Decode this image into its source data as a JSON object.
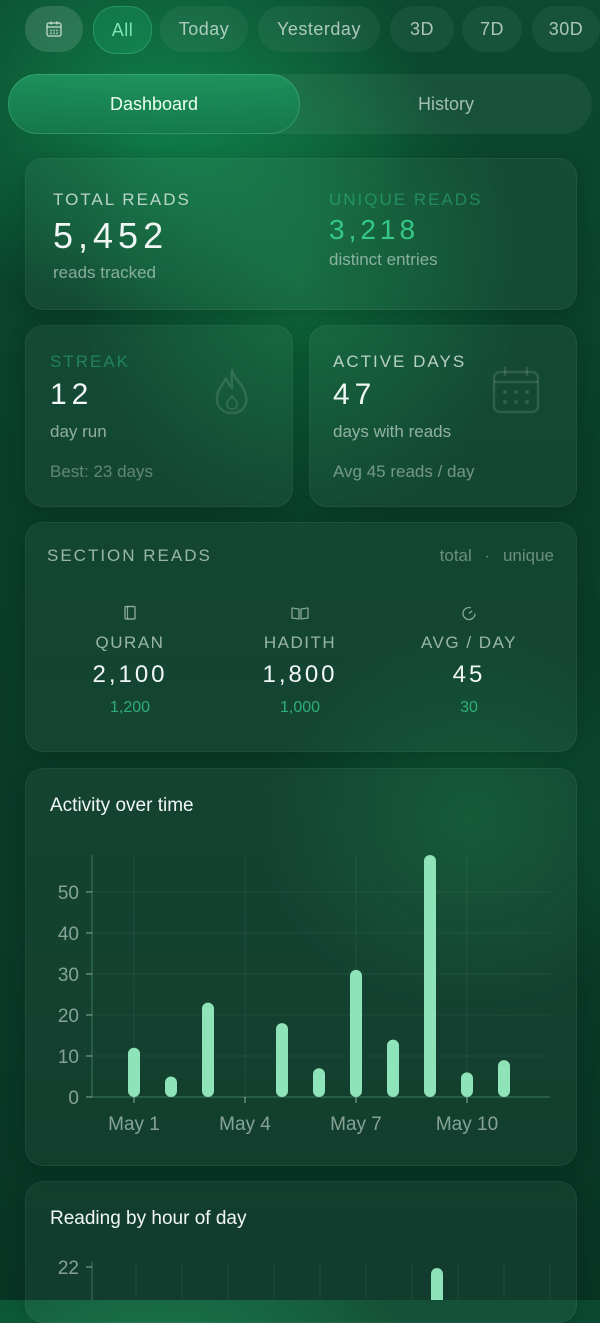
{
  "filters": {
    "calendar_icon": "calendar-icon",
    "chips": [
      {
        "label": "All",
        "active": true
      },
      {
        "label": "Today",
        "active": false
      },
      {
        "label": "Yesterday",
        "active": false
      },
      {
        "label": "3D",
        "active": false
      },
      {
        "label": "7D",
        "active": false
      },
      {
        "label": "30D",
        "active": false
      }
    ]
  },
  "tabs": [
    {
      "label": "Dashboard",
      "active": true
    },
    {
      "label": "History",
      "active": false
    }
  ],
  "summary": {
    "total": {
      "label": "TOTAL READS",
      "value": "5,452",
      "sub": "reads tracked"
    },
    "unique": {
      "label": "UNIQUE READS",
      "value": "3,218",
      "sub": "distinct entries"
    }
  },
  "streak": {
    "label": "STREAK",
    "value": "12",
    "sub": "day run",
    "best": "Best: 23 days",
    "icon": "flame-icon"
  },
  "active_days": {
    "label": "ACTIVE DAYS",
    "value": "47",
    "sub": "days with reads",
    "avg": "Avg 45 reads / day",
    "icon": "calendar-icon"
  },
  "section_reads": {
    "title": "SECTION READS",
    "legend_total": "total",
    "legend_sep": "·",
    "legend_unique": "unique",
    "columns": [
      {
        "name": "QURAN",
        "total": "2,100",
        "unique": "1,200",
        "icon": "book-icon"
      },
      {
        "name": "HADITH",
        "total": "1,800",
        "unique": "1,000",
        "icon": "open-book-icon"
      },
      {
        "name": "AVG / DAY",
        "total": "45",
        "unique": "30",
        "icon": "gauge-icon"
      }
    ]
  },
  "colors": {
    "accent": "#35c88a",
    "bar": "#8fe3b8",
    "background": "#0a3d2a"
  },
  "chart_data": [
    {
      "type": "bar",
      "title": "Activity over time",
      "x": [
        "May 1",
        "May 2",
        "May 3",
        "May 4",
        "May 5",
        "May 6",
        "May 7",
        "May 8",
        "May 9",
        "May 10",
        "May 11"
      ],
      "x_tick_labels": [
        "May 1",
        "May 4",
        "May 7",
        "May 10"
      ],
      "values": [
        12,
        5,
        23,
        0,
        18,
        7,
        31,
        14,
        59,
        6,
        9
      ],
      "ylim": [
        0,
        59
      ],
      "y_ticks": [
        0,
        10,
        20,
        30,
        40,
        50
      ],
      "grid": true
    },
    {
      "type": "bar",
      "title": "Reading by hour of day",
      "y_ticks": [
        22
      ],
      "grid": true
    }
  ]
}
